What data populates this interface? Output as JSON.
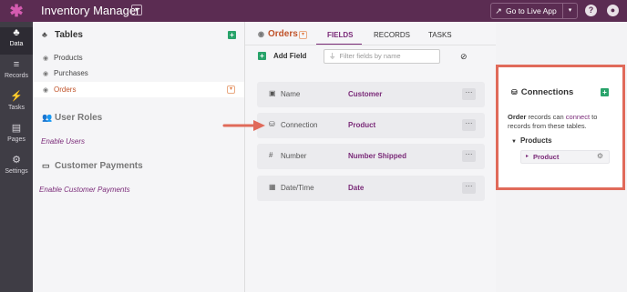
{
  "topbar": {
    "app_title": "Inventory Manager",
    "live_button_label": "Go to Live App",
    "external_icon": "↗",
    "caret": "▾",
    "help_icon": "?",
    "account_icon": "●"
  },
  "leftnav": {
    "items": [
      {
        "icon": "♣",
        "label": "Data",
        "active": true
      },
      {
        "icon": "≡",
        "label": "Records"
      },
      {
        "icon": "⚡",
        "label": "Tasks"
      },
      {
        "icon": "▤",
        "label": "Pages"
      },
      {
        "icon": "⚙",
        "label": "Settings"
      }
    ]
  },
  "sidebar": {
    "tables_title": "Tables",
    "tables_icon": "♣",
    "add_icon": "+",
    "tables": [
      {
        "label": "Products",
        "icon": "◉"
      },
      {
        "label": "Purchases",
        "icon": "◉"
      },
      {
        "label": "Orders",
        "icon": "◉",
        "active": true
      }
    ],
    "item_menu_icon": "▾",
    "user_roles_title": "User Roles",
    "user_roles_icon": "👥",
    "enable_users": "Enable Users",
    "customer_payments_title": "Customer Payments",
    "customer_payments_icon": "▭",
    "enable_payments": "Enable Customer Payments"
  },
  "main": {
    "table_name": "Orders",
    "table_icon": "◉",
    "table_caret": "▾",
    "tabs": [
      {
        "label": "FIELDS",
        "active": true
      },
      {
        "label": "RECORDS"
      },
      {
        "label": "TASKS"
      }
    ],
    "add_field_label": "Add Field",
    "add_icon": "+",
    "filter_placeholder": "Filter fields by name",
    "filter_icon": "⏚",
    "filter_off_icon": "⊘",
    "fields": [
      {
        "icon": "▣",
        "name": "Name",
        "value": "Customer"
      },
      {
        "icon": "⛁",
        "name": "Connection",
        "value": "Product"
      },
      {
        "icon": "#",
        "name": "Number",
        "value": "Number Shipped"
      },
      {
        "icon": "▦",
        "name": "Date/Time",
        "value": "Date"
      }
    ],
    "dots": "···"
  },
  "connections": {
    "title": "Connections",
    "icon": "⛁",
    "add_icon": "+",
    "desc_table": "Order",
    "desc_mid": " records can ",
    "desc_link": "connect",
    "desc_end": " to records from these tables.",
    "group_label": "Products",
    "group_icon": "▼",
    "item_label": "Product",
    "item_icon": "▸",
    "gear_icon": "⚙"
  },
  "colors": {
    "topbar": "#5b2c52",
    "accent_purple": "#7a2a78",
    "accent_orange": "#c0532a",
    "green": "#28a36a",
    "highlight_box": "#e06a5a"
  }
}
